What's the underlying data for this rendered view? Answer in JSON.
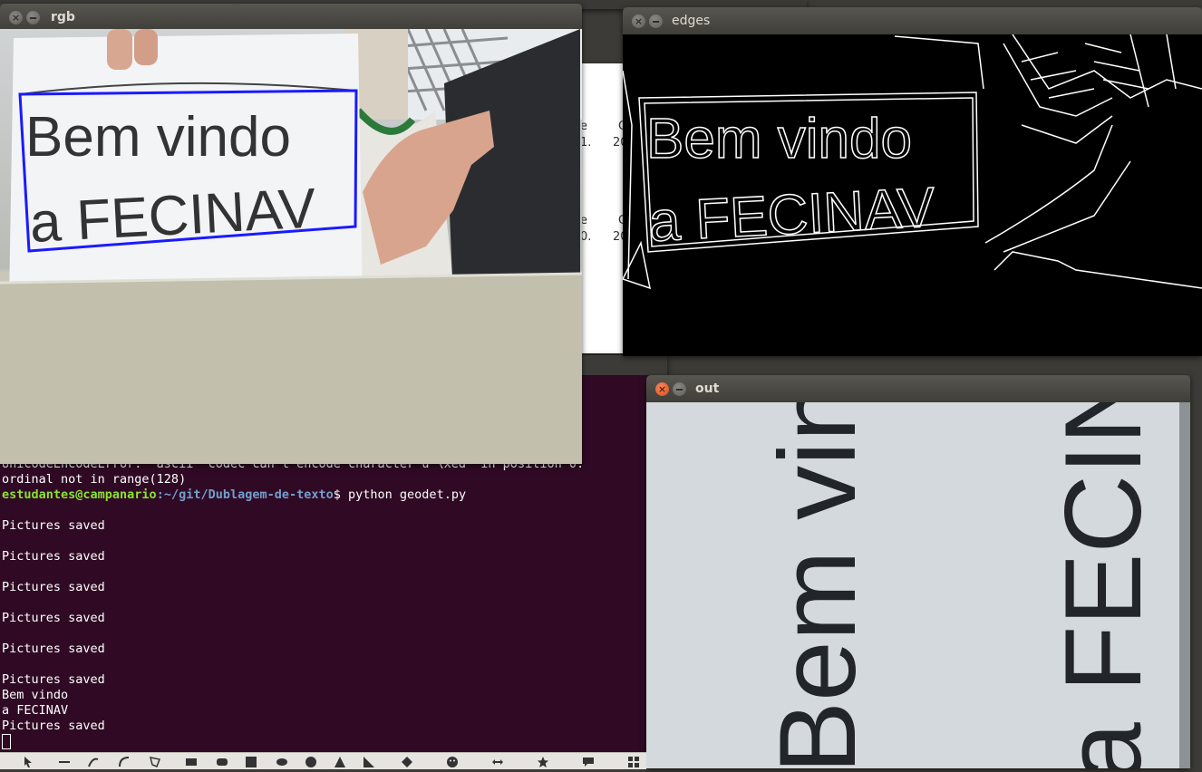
{
  "windows": {
    "rgb": {
      "title": "rgb"
    },
    "edges": {
      "title": "edges"
    },
    "out": {
      "title": "out"
    }
  },
  "sign": {
    "line1": "Bem vindo",
    "line2": "a FECINAV"
  },
  "background_doc": {
    "col1": [
      "e",
      "1.",
      "e",
      "0."
    ],
    "col2": [
      "C",
      "20",
      "C",
      "20"
    ]
  },
  "terminal": {
    "error_line1": "UnicodeEncodeError: 'ascii' codec can't encode character u'\\xed' in position 0:",
    "error_line2": "ordinal not in range(128)",
    "prompt_user": "estudantes@campanario",
    "prompt_path": ":~/git/Dublagem-de-texto",
    "prompt_symbol": "$ ",
    "command": "python geodet.py",
    "output": [
      "",
      "Pictures saved",
      "",
      "Pictures saved",
      "",
      "Pictures saved",
      "",
      "Pictures saved",
      "",
      "Pictures saved",
      "",
      "Pictures saved",
      "Bem vindo",
      "a FECINAV",
      "Pictures saved"
    ]
  },
  "colors": {
    "terminal_bg": "#300a24",
    "detection_box": "#1a1aff",
    "close_button": "#e05a2b"
  },
  "toolbar": {
    "tools": [
      "select-icon",
      "line-icon",
      "freehand-icon",
      "curve-icon",
      "polygon-icon",
      "rectangle-icon",
      "rounded-rect-icon",
      "square-icon",
      "ellipse-icon",
      "circle-icon",
      "triangle-icon",
      "right-triangle-icon",
      "diamond-icon",
      "smiley-icon",
      "double-arrow-icon",
      "star-icon",
      "callout-icon",
      "grid-icon"
    ]
  }
}
